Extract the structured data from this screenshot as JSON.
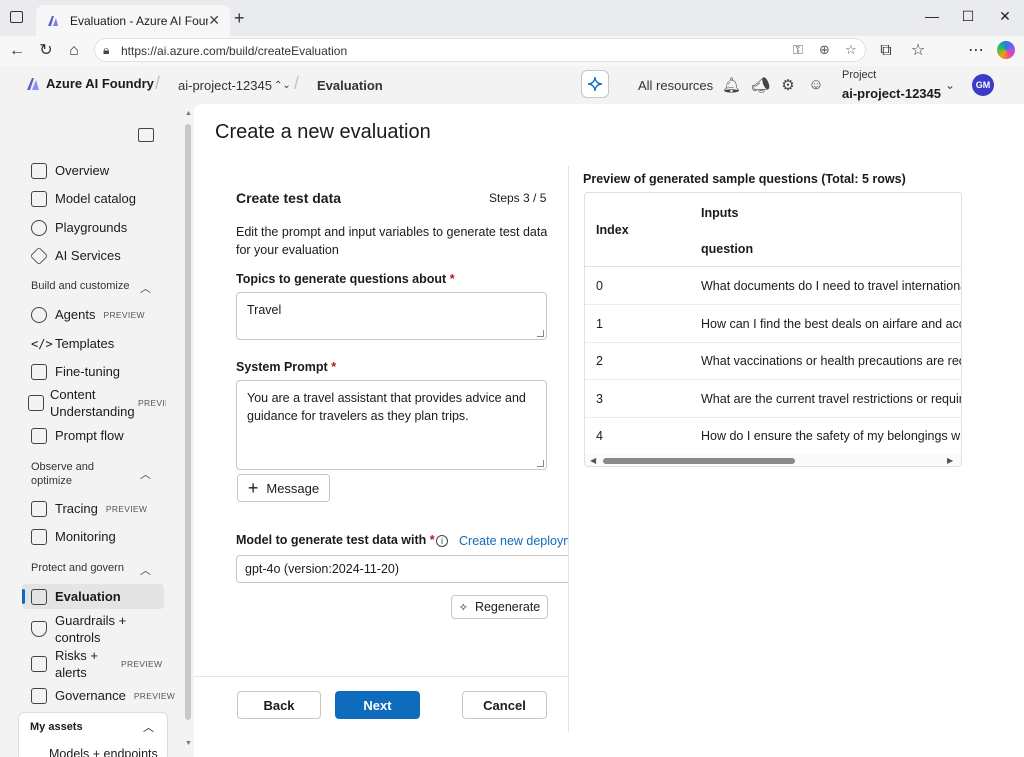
{
  "browser": {
    "tab_title": "Evaluation - Azure AI Foundry",
    "url": "https://ai.azure.com/build/createEvaluation"
  },
  "header": {
    "brand": "Azure AI Foundry",
    "project_crumb": "ai-project-12345",
    "page_crumb": "Evaluation",
    "all_resources": "All resources",
    "project_label": "Project",
    "project_name": "ai-project-12345",
    "avatar_initials": "GM"
  },
  "sidebar": {
    "top_items": [
      {
        "label": "Overview",
        "icon": "home-icon"
      },
      {
        "label": "Model catalog",
        "icon": "cube-icon"
      },
      {
        "label": "Playgrounds",
        "icon": "chat-icon"
      },
      {
        "label": "AI Services",
        "icon": "diamond-icon"
      }
    ],
    "build_section": "Build and customize",
    "build_items": [
      {
        "label": "Agents",
        "badge": "PREVIEW",
        "icon": "agent-icon"
      },
      {
        "label": "Templates",
        "icon": "code-icon"
      },
      {
        "label": "Fine-tuning",
        "icon": "flask-icon"
      },
      {
        "label": "Content Understanding",
        "badge": "PREVIEW",
        "icon": "document-icon"
      },
      {
        "label": "Prompt flow",
        "icon": "flow-icon"
      }
    ],
    "observe_section": "Observe and optimize",
    "observe_items": [
      {
        "label": "Tracing",
        "badge": "PREVIEW",
        "icon": "tracing-icon"
      },
      {
        "label": "Monitoring",
        "icon": "monitor-icon"
      }
    ],
    "protect_section": "Protect and govern",
    "protect_items": [
      {
        "label": "Evaluation",
        "icon": "scale-icon"
      },
      {
        "label": "Guardrails + controls",
        "icon": "shield-icon"
      },
      {
        "label": "Risks + alerts",
        "badge": "PREVIEW",
        "icon": "alert-icon"
      },
      {
        "label": "Governance",
        "badge": "PREVIEW",
        "icon": "bank-icon"
      }
    ],
    "my_assets": "My assets",
    "models_endpoints": "Models + endpoints"
  },
  "main": {
    "title": "Create a new evaluation",
    "card_title": "Create test data",
    "steps": "Steps 3 / 5",
    "description": "Edit the prompt and input variables to generate test data for your evaluation",
    "topics_label": "Topics to generate questions about",
    "topics_value": "Travel",
    "system_prompt_label": "System Prompt",
    "system_prompt_value": "You are a travel assistant that provides advice and guidance for travelers as they plan trips.",
    "message_button": "Message",
    "model_label": "Model to generate test data with",
    "create_link": "Create new deployment",
    "model_value": "gpt-4o (version:2024-11-20)",
    "regenerate_button": "Regenerate",
    "back_button": "Back",
    "next_button": "Next",
    "cancel_button": "Cancel",
    "required_mark": "*"
  },
  "preview": {
    "title": "Preview of generated sample questions (Total: 5 rows)",
    "col_index": "Index",
    "col_inputs": "Inputs",
    "col_question": "question",
    "rows": [
      {
        "index": "0",
        "question": "What documents do I need to travel internationally?"
      },
      {
        "index": "1",
        "question": "How can I find the best deals on airfare and accommodation?"
      },
      {
        "index": "2",
        "question": "What vaccinations or health precautions are recommended?"
      },
      {
        "index": "3",
        "question": "What are the current travel restrictions or requirements?"
      },
      {
        "index": "4",
        "question": "How do I ensure the safety of my belongings while traveling?"
      }
    ]
  },
  "colors": {
    "accent": "#0f6cbd",
    "required": "#c50f1f"
  }
}
